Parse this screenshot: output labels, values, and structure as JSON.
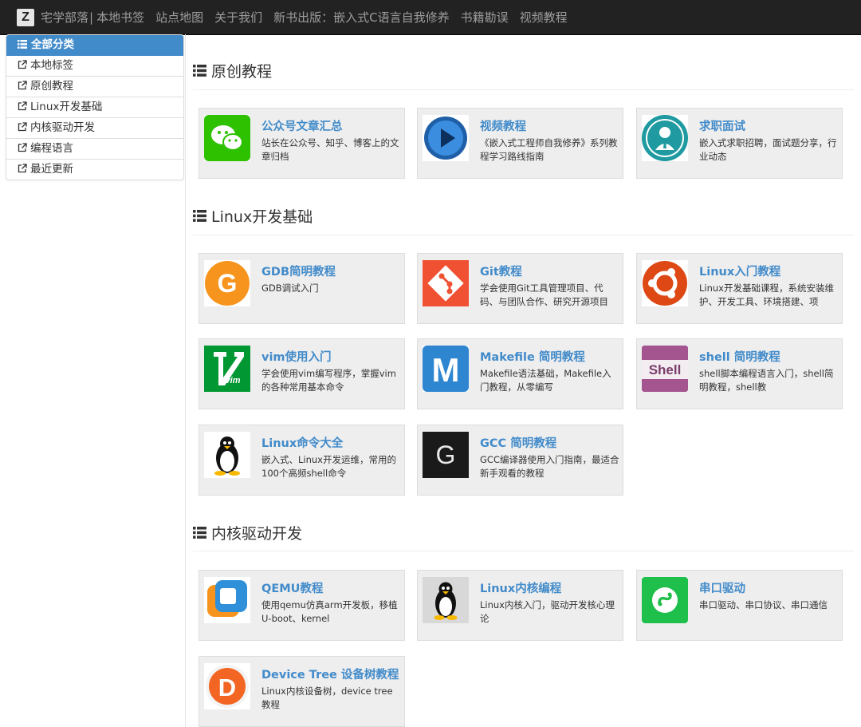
{
  "navbar": {
    "logo_letter": "Z",
    "brand": "宅学部落",
    "separator": "|",
    "links": [
      "本地书签",
      "站点地图",
      "关于我们",
      "新书出版：嵌入式C语言自我修养",
      "书籍勘误",
      "视频教程"
    ]
  },
  "sidebar": {
    "items": [
      {
        "label": "全部分类",
        "icon": "list-icon",
        "active": true
      },
      {
        "label": "本地标签",
        "icon": "external-link-icon"
      },
      {
        "label": "原创教程",
        "icon": "external-link-icon"
      },
      {
        "label": "Linux开发基础",
        "icon": "external-link-icon"
      },
      {
        "label": "内核驱动开发",
        "icon": "external-link-icon"
      },
      {
        "label": "编程语言",
        "icon": "external-link-icon"
      },
      {
        "label": "最近更新",
        "icon": "external-link-icon"
      }
    ]
  },
  "sections": [
    {
      "title": "原创教程",
      "cards": [
        {
          "title": "公众号文章汇总",
          "desc": "站长在公众号、知乎、博客上的文章归档",
          "icon": "wechat-icon"
        },
        {
          "title": "视频教程",
          "desc": "《嵌入式工程师自我修养》系列教程学习路线指南",
          "icon": "play-video-icon"
        },
        {
          "title": "求职面试",
          "desc": "嵌入式求职招聘，面试题分享，行业动态",
          "icon": "job-interview-icon"
        }
      ]
    },
    {
      "title": "Linux开发基础",
      "cards": [
        {
          "title": "GDB简明教程",
          "desc": "GDB调试入门",
          "icon": "gdb-icon"
        },
        {
          "title": "Git教程",
          "desc": "学会使用Git工具管理项目、代码、与团队合作、研究开源项目",
          "icon": "git-icon"
        },
        {
          "title": "Linux入门教程",
          "desc": "Linux开发基础课程，系统安装维护、开发工具、环境搭建、项",
          "icon": "ubuntu-icon"
        },
        {
          "title": "vim使用入门",
          "desc": "学会使用vim编写程序，掌握vim的各种常用基本命令",
          "icon": "vim-icon"
        },
        {
          "title": "Makefile 简明教程",
          "desc": "Makefile语法基础，Makefile入门教程，从零编写",
          "icon": "makefile-icon"
        },
        {
          "title": "shell 简明教程",
          "desc": "shell脚本编程语言入门，shell简明教程，shell教",
          "icon": "shell-icon"
        },
        {
          "title": "Linux命令大全",
          "desc": "嵌入式、Linux开发运维，常用的100个高频shell命令",
          "icon": "tux-icon"
        },
        {
          "title": "GCC 简明教程",
          "desc": "GCC编译器使用入门指南，最适合新手观看的教程",
          "icon": "gcc-icon"
        }
      ]
    },
    {
      "title": "内核驱动开发",
      "cards": [
        {
          "title": "QEMU教程",
          "desc": "使用qemu仿真arm开发板，移植U-boot、kernel",
          "icon": "qemu-icon"
        },
        {
          "title": "Linux内核编程",
          "desc": "Linux内核入门，驱动开发核心理论",
          "icon": "tux-kernel-icon"
        },
        {
          "title": "串口驱动",
          "desc": "串口驱动、串口协议、串口通信",
          "icon": "serial-driver-icon"
        },
        {
          "title": "Device Tree 设备树教程",
          "desc": "Linux内核设备树，device tree教程",
          "icon": "device-tree-icon"
        }
      ]
    }
  ],
  "colors": {
    "navbar_bg": "#222222",
    "link_blue": "#428bca",
    "card_bg": "#eeeeee"
  }
}
